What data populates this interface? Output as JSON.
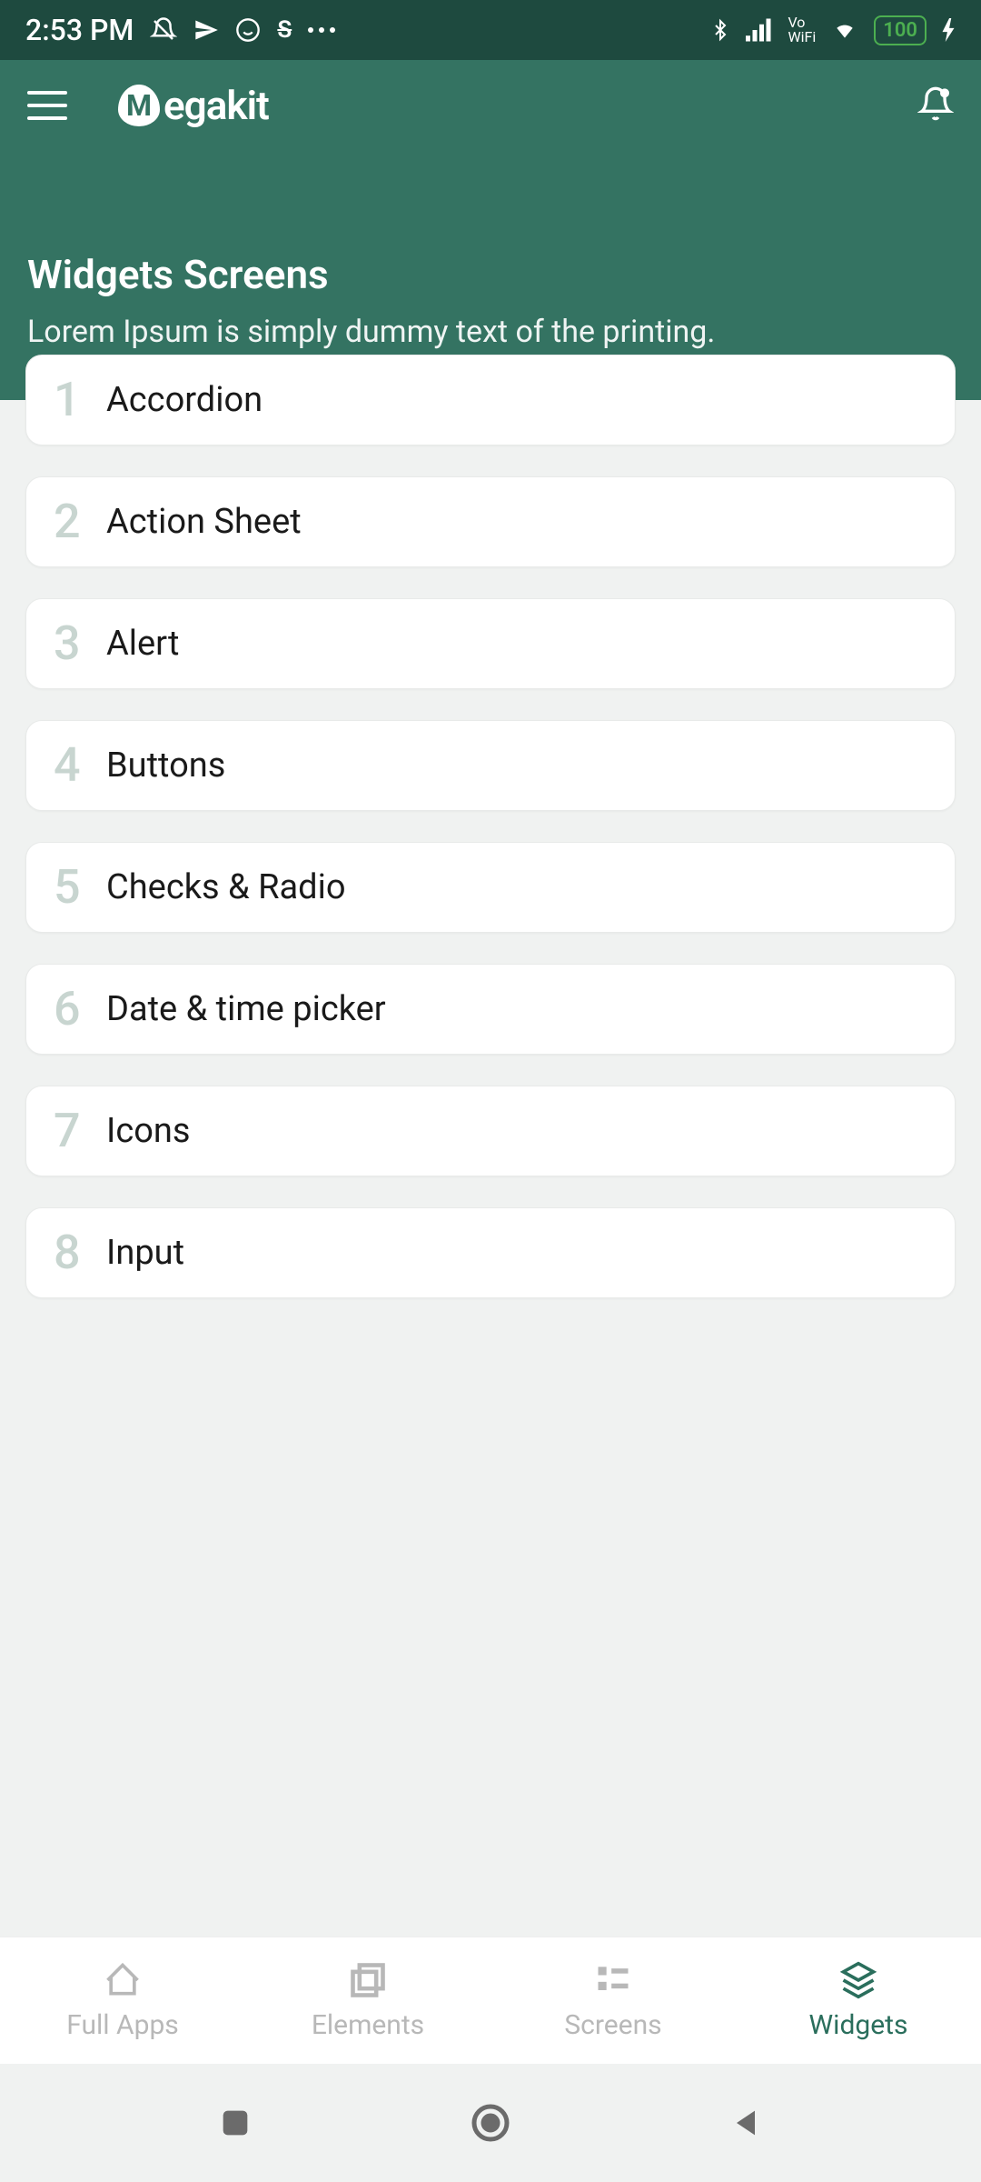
{
  "status": {
    "time": "2:53 PM",
    "battery": "100"
  },
  "app": {
    "name": "egakit"
  },
  "page": {
    "title": "Widgets Screens",
    "subtitle": "Lorem Ipsum is simply dummy text of the printing."
  },
  "widgets": [
    {
      "num": "1",
      "label": "Accordion"
    },
    {
      "num": "2",
      "label": "Action Sheet"
    },
    {
      "num": "3",
      "label": "Alert"
    },
    {
      "num": "4",
      "label": "Buttons"
    },
    {
      "num": "5",
      "label": "Checks & Radio"
    },
    {
      "num": "6",
      "label": "Date & time picker"
    },
    {
      "num": "7",
      "label": "Icons"
    },
    {
      "num": "8",
      "label": "Input"
    }
  ],
  "nav": {
    "items": [
      {
        "label": "Full Apps",
        "active": false
      },
      {
        "label": "Elements",
        "active": false
      },
      {
        "label": "Screens",
        "active": false
      },
      {
        "label": "Widgets",
        "active": true
      }
    ]
  }
}
